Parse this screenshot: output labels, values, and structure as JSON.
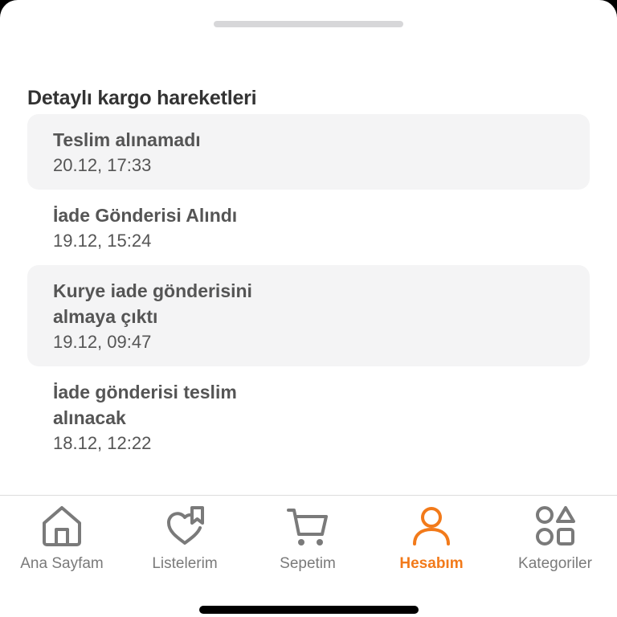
{
  "sheet": {
    "section_title": "Detaylı kargo hareketleri"
  },
  "events": [
    {
      "status": "Teslim alınamadı",
      "time": "20.12, 17:33"
    },
    {
      "status": "İade Gönderisi Alındı",
      "time": "19.12, 15:24"
    },
    {
      "status": "Kurye iade gönderisini almaya çıktı",
      "time": "19.12, 09:47"
    },
    {
      "status": "İade gönderisi teslim alınacak",
      "time": "18.12, 12:22"
    }
  ],
  "tabbar": {
    "items": [
      {
        "label": "Ana Sayfam",
        "icon": "home-icon"
      },
      {
        "label": "Listelerim",
        "icon": "heart-bookmark-icon"
      },
      {
        "label": "Sepetim",
        "icon": "cart-icon"
      },
      {
        "label": "Hesabım",
        "icon": "user-icon",
        "active": true
      },
      {
        "label": "Kategoriler",
        "icon": "categories-icon"
      }
    ]
  },
  "colors": {
    "accent": "#f27a1a",
    "text": "#555555",
    "title": "#333333",
    "row_shade": "#f4f4f5",
    "tab_inactive": "#7a7a7a"
  }
}
